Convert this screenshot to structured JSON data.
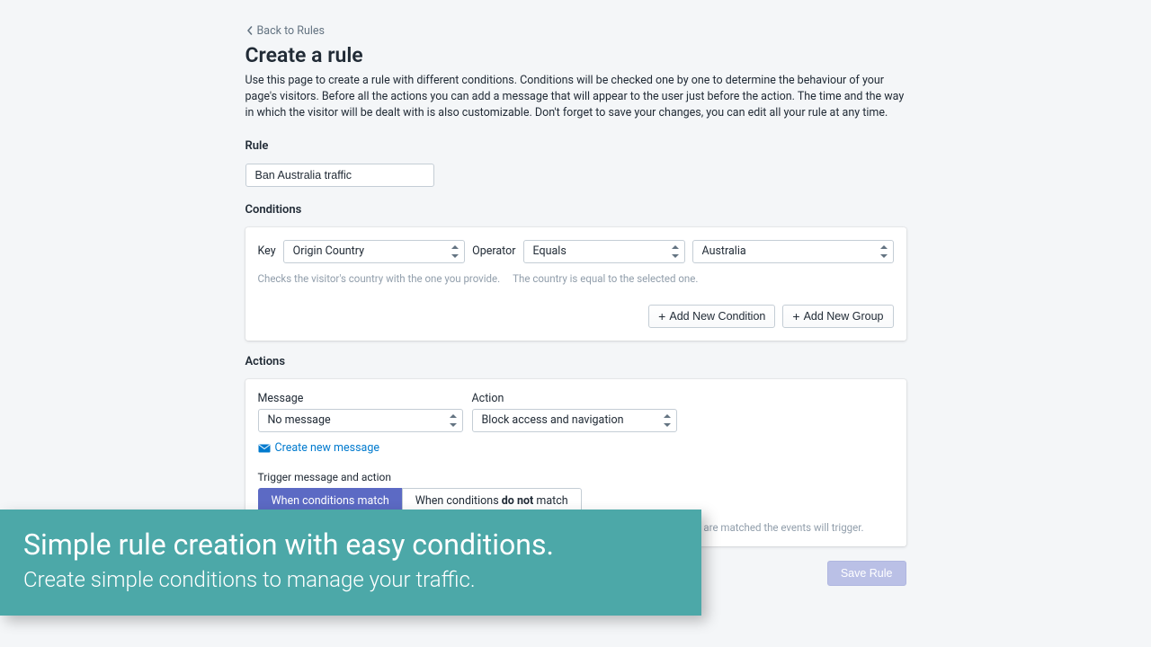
{
  "header": {
    "back_label": "Back to Rules",
    "title": "Create a rule",
    "description": "Use this page to create a rule with different conditions. Conditions will be checked one by one to determine the behaviour of your page's visitors. Before all the actions you can add a message that will appear to the user just before the action. The time and the way in which the visitor will be dealt with is also customizable. Don't forget to save your changes, you can edit all your rule at any time."
  },
  "rule": {
    "section_label": "Rule",
    "name_value": "Ban Australia traffic"
  },
  "conditions": {
    "section_label": "Conditions",
    "key_label": "Key",
    "key_value": "Origin Country",
    "key_help": "Checks the visitor's country with the one you provide.",
    "operator_label": "Operator",
    "operator_value": "Equals",
    "operator_help": "The country is equal to the selected one.",
    "value_value": "Australia",
    "add_condition_label": "Add New Condition",
    "add_group_label": "Add New Group"
  },
  "actions": {
    "section_label": "Actions",
    "message_label": "Message",
    "message_value": "No message",
    "action_label": "Action",
    "action_value": "Block access and navigation",
    "create_message_label": "Create new message",
    "trigger_label": "Trigger message and action",
    "trigger_match": "When conditions match",
    "trigger_not_match_prefix": "When conditions ",
    "trigger_not_match_bold": "do not",
    "trigger_not_match_suffix": " match",
    "trigger_help": "The selected message and action will be triggered only when conditions match. When conditions are matched the events will trigger."
  },
  "save_label": "Save Rule",
  "overlay": {
    "title": "Simple rule creation with easy conditions.",
    "subtitle": "Create simple conditions to manage your traffic."
  }
}
